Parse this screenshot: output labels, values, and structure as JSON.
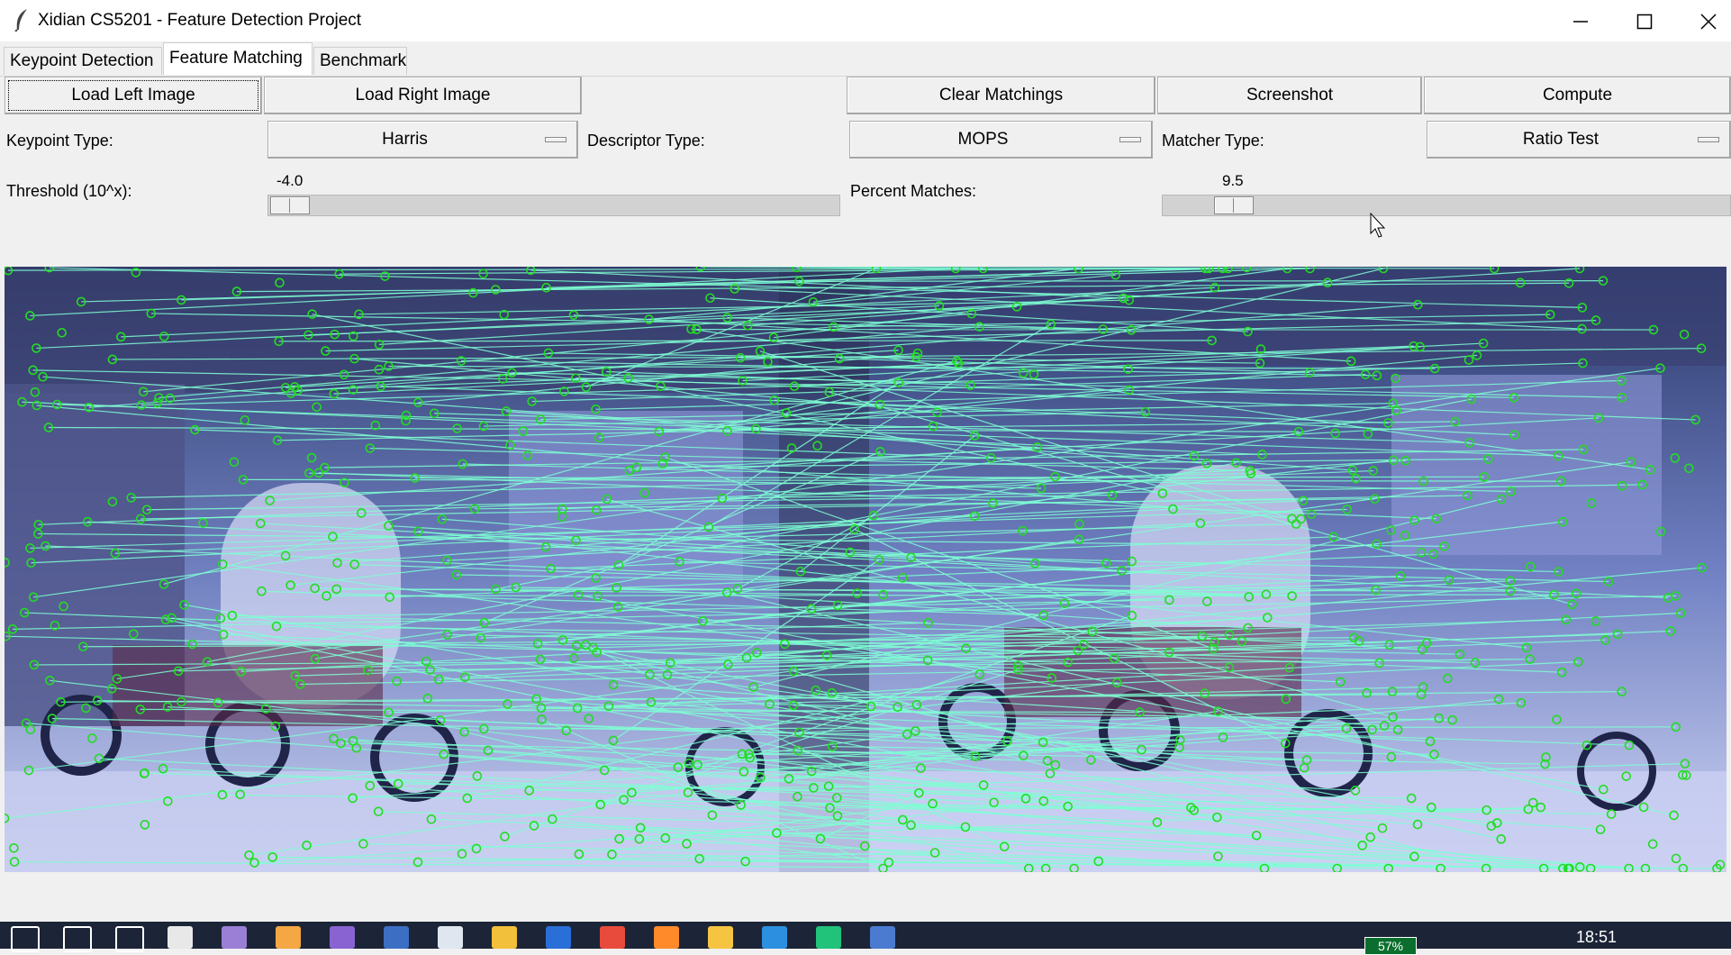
{
  "window": {
    "title": "Xidian CS5201 - Feature Detection Project",
    "icon": "feather-icon",
    "controls": [
      "minimize-icon",
      "maximize-icon",
      "close-icon"
    ]
  },
  "tabs": [
    {
      "label": "Keypoint Detection",
      "active": false
    },
    {
      "label": "Feature Matching",
      "active": true
    },
    {
      "label": "Benchmark",
      "active": false
    }
  ],
  "toolbar": {
    "load_left": "Load Left Image",
    "load_right": "Load Right Image",
    "clear": "Clear Matchings",
    "screenshot": "Screenshot",
    "compute": "Compute"
  },
  "options": {
    "keypoint_label": "Keypoint Type:",
    "keypoint_value": "Harris",
    "descriptor_label": "Descriptor Type:",
    "descriptor_value": "MOPS",
    "matcher_label": "Matcher Type:",
    "matcher_value": "Ratio Test"
  },
  "threshold": {
    "label": "Threshold (10^x):",
    "value": "-4.0",
    "level": 0.0
  },
  "percent": {
    "label": "Percent Matches:",
    "value": "9.5",
    "level": 0.095
  },
  "colors": {
    "match_line": "#7fffd4",
    "keypoint": "#22dd22",
    "accent": "#0078d7",
    "taskbar": "#1c2537"
  },
  "taskbar": {
    "icons": [
      "windows-start-icon",
      "search-icon",
      "task-view-icon",
      "calculator-icon",
      "app-icon",
      "eclipse-icon",
      "visual-studio-icon",
      "dev-cpp-icon",
      "notepad-icon",
      "app-icon-2",
      "mp-icon",
      "chrome-icon",
      "firefox-icon",
      "file-explorer-icon",
      "vz-icon",
      "pycharm-icon",
      "tk-app-icon"
    ],
    "battery": "57%",
    "time": "18:51"
  }
}
